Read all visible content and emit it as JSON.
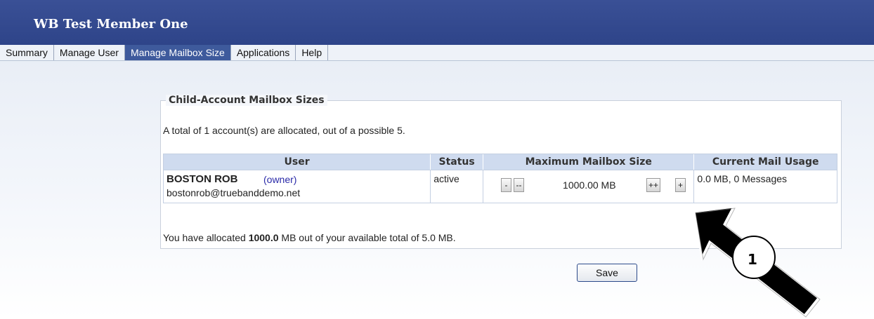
{
  "header": {
    "title": "WB Test Member One"
  },
  "tabs": [
    {
      "label": "Summary",
      "active": false
    },
    {
      "label": "Manage User",
      "active": false
    },
    {
      "label": "Manage Mailbox Size",
      "active": true
    },
    {
      "label": "Applications",
      "active": false
    },
    {
      "label": "Help",
      "active": false
    }
  ],
  "section": {
    "legend": "Child-Account Mailbox Sizes",
    "summary": "A total of 1 account(s) are allocated, out of a possible 5."
  },
  "table": {
    "columns": [
      "User",
      "Status",
      "Maximum Mailbox Size",
      "Current Mail Usage"
    ],
    "rows": [
      {
        "name": "BOSTON ROB",
        "role": "(owner)",
        "email": "bostonrob@truebanddemo.net",
        "status": "active",
        "buttons": {
          "minus_minus": "-",
          "minus": "--",
          "plus_plus": "++",
          "plus": "+"
        },
        "max_size": "1000.00 MB",
        "usage": "0.0 MB, 0 Messages"
      }
    ]
  },
  "allocation": {
    "prefix": "You have allocated",
    "amount": "1000.0",
    "suffix": " MB out of your available total of 5.0 MB."
  },
  "save_label": "Save",
  "callout": {
    "number": "1",
    "icon": "arrow-callout-icon",
    "color": "#000000"
  },
  "colors": {
    "header_bg": "#2e4489",
    "active_tab": "#3e5a9c",
    "table_header": "#cfdbef"
  }
}
